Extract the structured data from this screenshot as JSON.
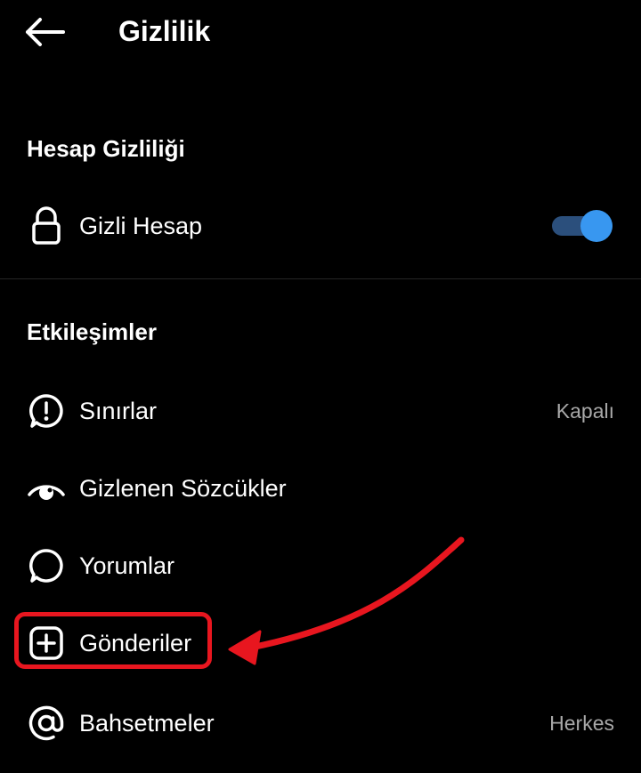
{
  "header": {
    "title": "Gizlilik",
    "back_icon": "arrow-left-icon"
  },
  "sections": {
    "account_privacy": {
      "title": "Hesap Gizliliği",
      "private_account": {
        "label": "Gizli Hesap",
        "icon": "lock-icon",
        "toggle_on": true
      }
    },
    "interactions": {
      "title": "Etkileşimler",
      "items": [
        {
          "label": "Sınırlar",
          "value": "Kapalı",
          "icon": "alert-bubble-icon"
        },
        {
          "label": "Gizlenen Sözcükler",
          "value": "",
          "icon": "eye-icon"
        },
        {
          "label": "Yorumlar",
          "value": "",
          "icon": "comment-bubble-icon"
        },
        {
          "label": "Gönderiler",
          "value": "",
          "icon": "plus-square-icon"
        },
        {
          "label": "Bahsetmeler",
          "value": "Herkes",
          "icon": "at-sign-icon"
        }
      ]
    }
  },
  "annotation": {
    "color": "#e8161f",
    "highlighted_item": "Gönderiler"
  },
  "colors": {
    "background": "#000000",
    "text": "#ffffff",
    "secondary_text": "#a8a8a8",
    "toggle_knob": "#3897f0",
    "toggle_track": "#2b4f7c",
    "divider": "#262626"
  }
}
